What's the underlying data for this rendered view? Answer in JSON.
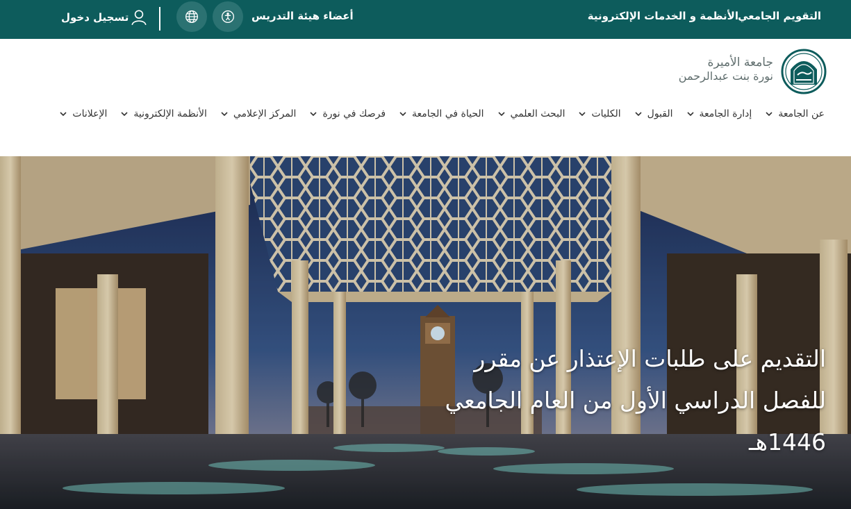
{
  "topbar": {
    "calendar_label": "التقويم الجامعي",
    "systems_label": "الأنظمة و الخدمات الإلكترونية",
    "faculty_label": "أعضاء هيئة التدريس",
    "login_label": "تسجيل دخول",
    "background": "#0d5c5c"
  },
  "logo": {
    "line1": "جامعة الأميرة",
    "line2": "نورة بنت عبدالرحمن"
  },
  "nav": {
    "items": [
      {
        "label": "عن الجامعة"
      },
      {
        "label": "إدارة الجامعة"
      },
      {
        "label": "القبول"
      },
      {
        "label": "الكليات"
      },
      {
        "label": "البحث العلمي"
      },
      {
        "label": "الحياة في الجامعة"
      },
      {
        "label": "فرصك في نورة"
      },
      {
        "label": "المركز الإعلامي"
      },
      {
        "label": "الأنظمة الإلكترونية"
      },
      {
        "label": "الإعلانات"
      }
    ]
  },
  "hero": {
    "title_line1": "التقديم على طلبات الإعتذار عن مقرر",
    "title_line2": "للفصل الدراسي الأول من العام الجامعي",
    "title_line3": "1446هـ"
  },
  "icons": {
    "accessibility": "accessibility-icon",
    "globe": "globe-icon",
    "user": "user-icon",
    "chevron": "chevron-down-icon"
  }
}
